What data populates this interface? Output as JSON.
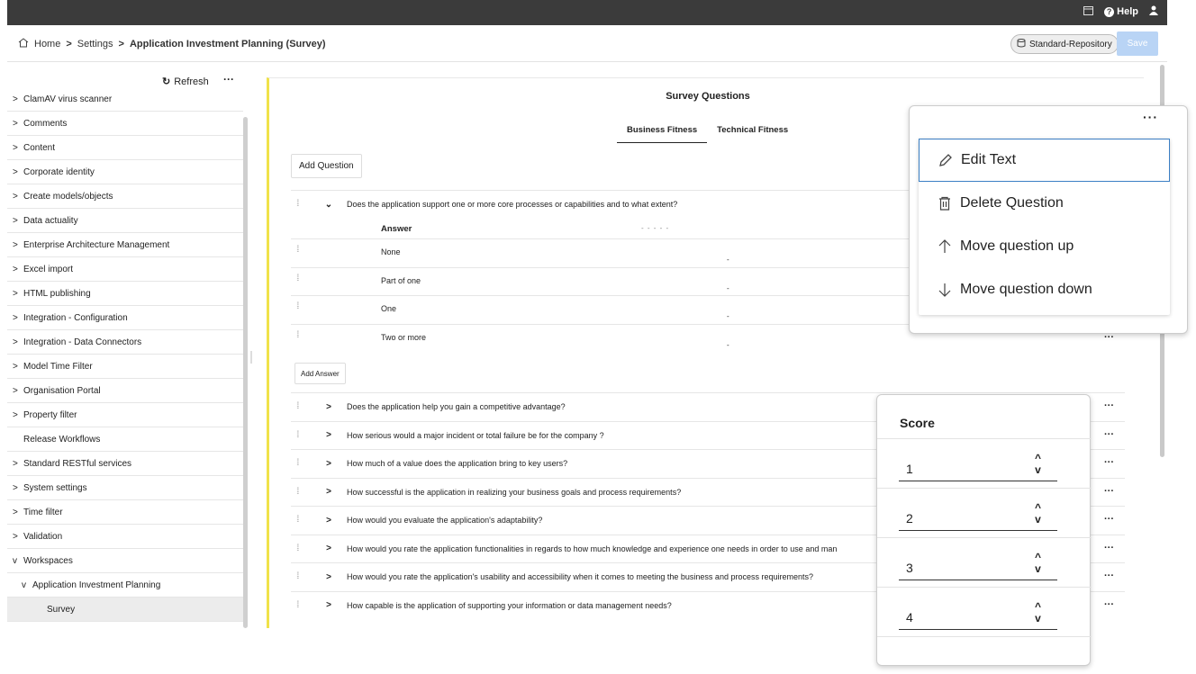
{
  "topbar": {
    "help_label": "Help"
  },
  "breadcrumb": {
    "home": "Home",
    "settings": "Settings",
    "current": "Application Investment Planning (Survey)"
  },
  "header": {
    "repository": "Standard-Repository",
    "save_label": "Save"
  },
  "sidebar": {
    "refresh_label": "Refresh",
    "more_label": "···",
    "items": [
      {
        "label": "ClamAV virus scanner",
        "chevron": ">"
      },
      {
        "label": "Comments",
        "chevron": ">"
      },
      {
        "label": "Content",
        "chevron": ">"
      },
      {
        "label": "Corporate identity",
        "chevron": ">"
      },
      {
        "label": "Create models/objects",
        "chevron": ">"
      },
      {
        "label": "Data actuality",
        "chevron": ">"
      },
      {
        "label": "Enterprise Architecture Management",
        "chevron": ">"
      },
      {
        "label": "Excel import",
        "chevron": ">"
      },
      {
        "label": "HTML publishing",
        "chevron": ">"
      },
      {
        "label": "Integration - Configuration",
        "chevron": ">"
      },
      {
        "label": "Integration - Data Connectors",
        "chevron": ">"
      },
      {
        "label": "Model Time Filter",
        "chevron": ">"
      },
      {
        "label": "Organisation Portal",
        "chevron": ">"
      },
      {
        "label": "Property filter",
        "chevron": ">"
      },
      {
        "label": "Release Workflows",
        "chevron": ""
      },
      {
        "label": "Standard RESTful services",
        "chevron": ">"
      },
      {
        "label": "System settings",
        "chevron": ">"
      },
      {
        "label": "Time filter",
        "chevron": ">"
      },
      {
        "label": "Validation",
        "chevron": ">"
      },
      {
        "label": "Workspaces",
        "chevron": "v"
      },
      {
        "label": "Application Investment Planning",
        "chevron": "v"
      },
      {
        "label": "Survey",
        "chevron": ""
      }
    ]
  },
  "main": {
    "title": "Survey Questions",
    "tabs": [
      "Business Fitness",
      "Technical Fitness"
    ],
    "add_question": "Add Question",
    "add_answer": "Add Answer",
    "answer_header": "Answer",
    "answer_dash": "- - - - -",
    "expanded_question": "Does the application support one or more core processes or capabilities and to what extent?",
    "answers": [
      "None",
      "Part of one",
      "One",
      "Two or more"
    ],
    "answer_dot": "-",
    "questions": [
      "Does the application help you gain a competitive advantage?",
      "How serious would a major incident or total failure be for the company ?",
      "How much of a value does the application bring to key users?",
      "How successful is the application in realizing your business goals and process requirements?",
      "How would you evaluate the application's adaptability?",
      "How would you rate the application functionalities in regards to how much knowledge and experience one needs in order to use and man",
      "How would you rate the application's usability and accessibility when it comes to meeting the business and process requirements?",
      "How capable is the application of supporting your information or data management needs?"
    ],
    "more_label": "···"
  },
  "context_menu": {
    "dots": "···",
    "items": [
      "Edit Text",
      "Delete Question",
      "Move question up",
      "Move question down"
    ]
  },
  "score_popup": {
    "title": "Score",
    "values": [
      "1",
      "2",
      "3",
      "4"
    ]
  }
}
